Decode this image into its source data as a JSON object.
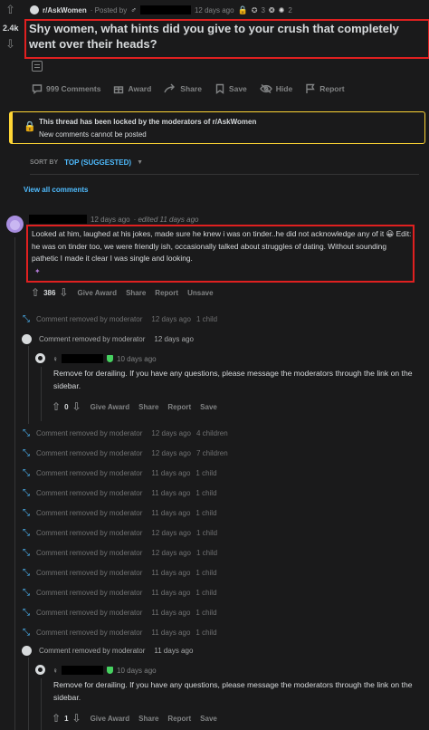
{
  "post": {
    "subreddit": "r/AskWomen",
    "posted_by_prefix": "· Posted by",
    "time_ago": "12 days ago",
    "award_count_1": "3",
    "award_count_2": "2",
    "vote_count": "2.4k",
    "title": "Shy women, what hints did you give to your crush that completely went over their heads?",
    "actions": {
      "comments": "999 Comments",
      "award": "Award",
      "share": "Share",
      "save": "Save",
      "hide": "Hide",
      "report": "Report"
    }
  },
  "lock_notice": {
    "title": "This thread has been locked by the moderators of r/AskWomen",
    "subtitle": "New comments cannot be posted"
  },
  "sort": {
    "label": "SORT BY",
    "value": "TOP (SUGGESTED)"
  },
  "view_all": "View all comments",
  "top_comment": {
    "time_ago": "12 days ago",
    "edited": "· edited 11 days ago",
    "body": "Looked at him, laughed at his jokes, made sure he knew i was on tinder..he did not acknowledge any of it 😀 Edit: he was on tinder too, we were friendly ish, occasionally talked about struggles of dating. Without sounding pathetic I made it clear I was single and looking.",
    "votes": "386",
    "give_award": "Give Award",
    "share": "Share",
    "report": "Report",
    "unsave": "Unsave"
  },
  "removed_label": "Comment removed by moderator",
  "removed_rows": [
    {
      "time": "12 days ago",
      "children": "1 child"
    },
    {
      "time": "12 days ago",
      "children": ""
    },
    {
      "time": "12 days ago",
      "children": "4 children"
    },
    {
      "time": "12 days ago",
      "children": "7 children"
    },
    {
      "time": "11 days ago",
      "children": "1 child"
    },
    {
      "time": "11 days ago",
      "children": "1 child"
    },
    {
      "time": "11 days ago",
      "children": "1 child"
    },
    {
      "time": "12 days ago",
      "children": "1 child"
    },
    {
      "time": "12 days ago",
      "children": "1 child"
    },
    {
      "time": "11 days ago",
      "children": "1 child"
    },
    {
      "time": "11 days ago",
      "children": "1 child"
    },
    {
      "time": "11 days ago",
      "children": "1 child"
    },
    {
      "time": "11 days ago",
      "children": "1 child"
    },
    {
      "time": "11 days ago",
      "children": ""
    }
  ],
  "mod_reply_1": {
    "time": "10 days ago",
    "body": "Remove for derailing. If you have any questions, please message the moderators through the link on the sidebar.",
    "votes": "0",
    "give_award": "Give Award",
    "share": "Share",
    "report": "Report",
    "save": "Save"
  },
  "mod_reply_2": {
    "time": "10 days ago",
    "body": "Remove for derailing. If you have any questions, please message the moderators through the link on the sidebar.",
    "votes": "1",
    "give_award": "Give Award",
    "share": "Share",
    "report": "Report",
    "save": "Save"
  },
  "colors": {
    "background": "#1a1a1b",
    "highlight_box": "#e02020",
    "link_blue": "#4fbcff",
    "lock_yellow": "#ffd635",
    "avatar_purple": "#a98fe0"
  }
}
